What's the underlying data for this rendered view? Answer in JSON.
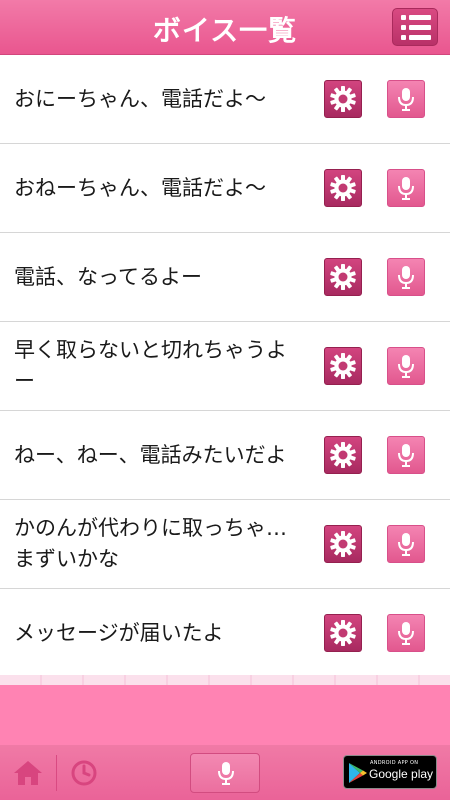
{
  "header": {
    "title": "ボイス一覧",
    "menu_icon": "list-menu-icon"
  },
  "voices": [
    {
      "label": "おにーちゃん、電話だよ～"
    },
    {
      "label": "おねーちゃん、電話だよ～"
    },
    {
      "label": "電話、なってるよー"
    },
    {
      "label": "早く取らないと切れちゃうよー"
    },
    {
      "label": "ねー、ねー、電話みたいだよ"
    },
    {
      "label": "かのんが代わりに取っちゃ…まずいかな"
    },
    {
      "label": "メッセージが届いたよ"
    }
  ],
  "row_icons": {
    "settings": "gear-icon",
    "play": "microphone-icon"
  },
  "footer": {
    "home_icon": "home-icon",
    "history_icon": "clock-icon",
    "mic_icon": "microphone-icon",
    "badge": {
      "small_text": "ANDROID APP ON",
      "big_text": "Google play"
    }
  },
  "colors": {
    "header": "#e9568f",
    "gear_button": "#b93168",
    "mic_button": "#e95f95",
    "pink_band": "#ff83b3",
    "footer": "#ec6b9c"
  }
}
